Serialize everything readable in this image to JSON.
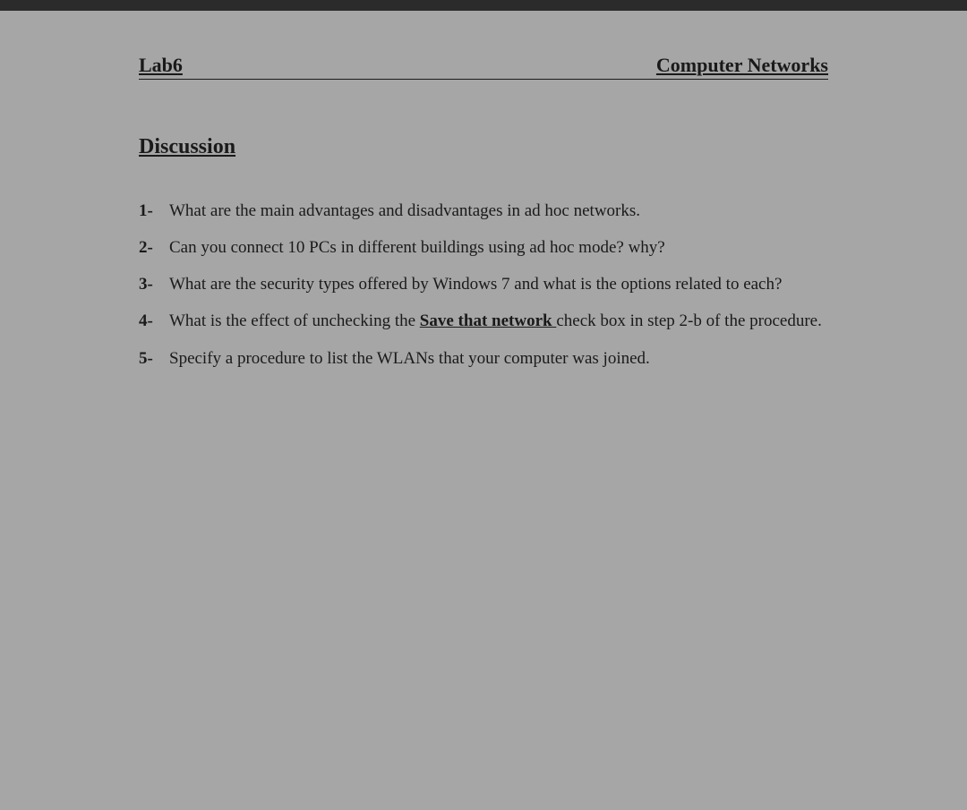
{
  "header": {
    "left": "Lab6",
    "right": "Computer Networks"
  },
  "section_title": "Discussion",
  "questions": [
    {
      "number": "1-",
      "text_before": "What are the main advantages and disadvantages in ad hoc networks.",
      "underline": "",
      "text_after": ""
    },
    {
      "number": "2-",
      "text_before": "Can you connect 10 PCs in different buildings using ad hoc mode? why?",
      "underline": "",
      "text_after": ""
    },
    {
      "number": "3-",
      "text_before": "What are the security types offered by  Windows 7 and what is the options related to each?",
      "underline": "",
      "text_after": ""
    },
    {
      "number": "4-",
      "text_before": "What is the effect of unchecking the ",
      "underline": "Save that network ",
      "text_after": " check box in step 2-b of the procedure."
    },
    {
      "number": "5-",
      "text_before": "Specify a procedure to list the WLANs that your computer was joined.",
      "underline": "",
      "text_after": ""
    }
  ]
}
